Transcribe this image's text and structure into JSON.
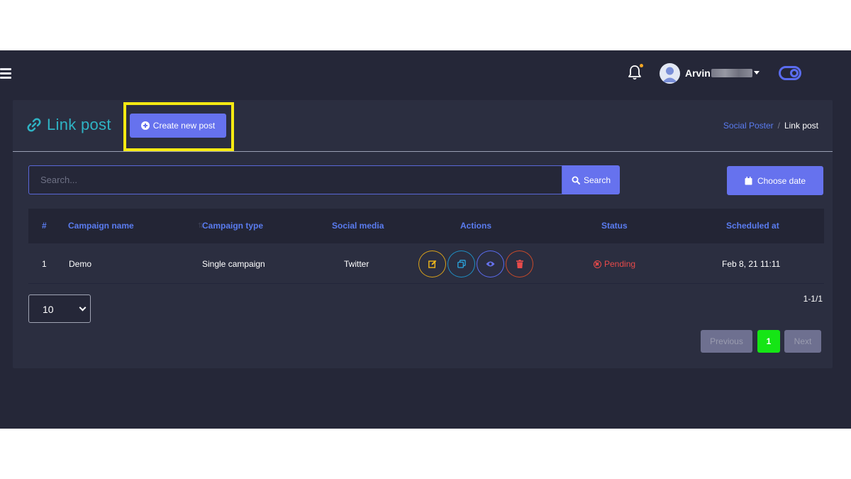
{
  "header": {
    "username": "Arvin"
  },
  "page": {
    "title": "Link post",
    "create_button_label": "Create new post",
    "breadcrumb": [
      "Social Poster",
      "Link post"
    ]
  },
  "search": {
    "placeholder": "Search...",
    "button_label": "Search",
    "date_button_label": "Choose date"
  },
  "table": {
    "columns": [
      "#",
      "Campaign name",
      "Campaign type",
      "Social media",
      "Actions",
      "Status",
      "Scheduled at"
    ],
    "rows": [
      {
        "index": "1",
        "campaign_name": "Demo",
        "campaign_type": "Single campaign",
        "social_media": "Twitter",
        "actions": [
          "edit-icon",
          "copy-icon",
          "eye-icon",
          "trash-icon"
        ],
        "status": "Pending",
        "scheduled_at": "Feb 8, 21 11:11"
      }
    ]
  },
  "pagination": {
    "per_page": "10",
    "range": "1-1/1",
    "previous_label": "Previous",
    "current_page": "1",
    "next_label": "Next"
  },
  "colors": {
    "accent": "#6672ee",
    "title": "#2fb3c4",
    "highlight": "#f6ea12",
    "status_pending": "#e84a4a",
    "active_page": "#15e515"
  }
}
